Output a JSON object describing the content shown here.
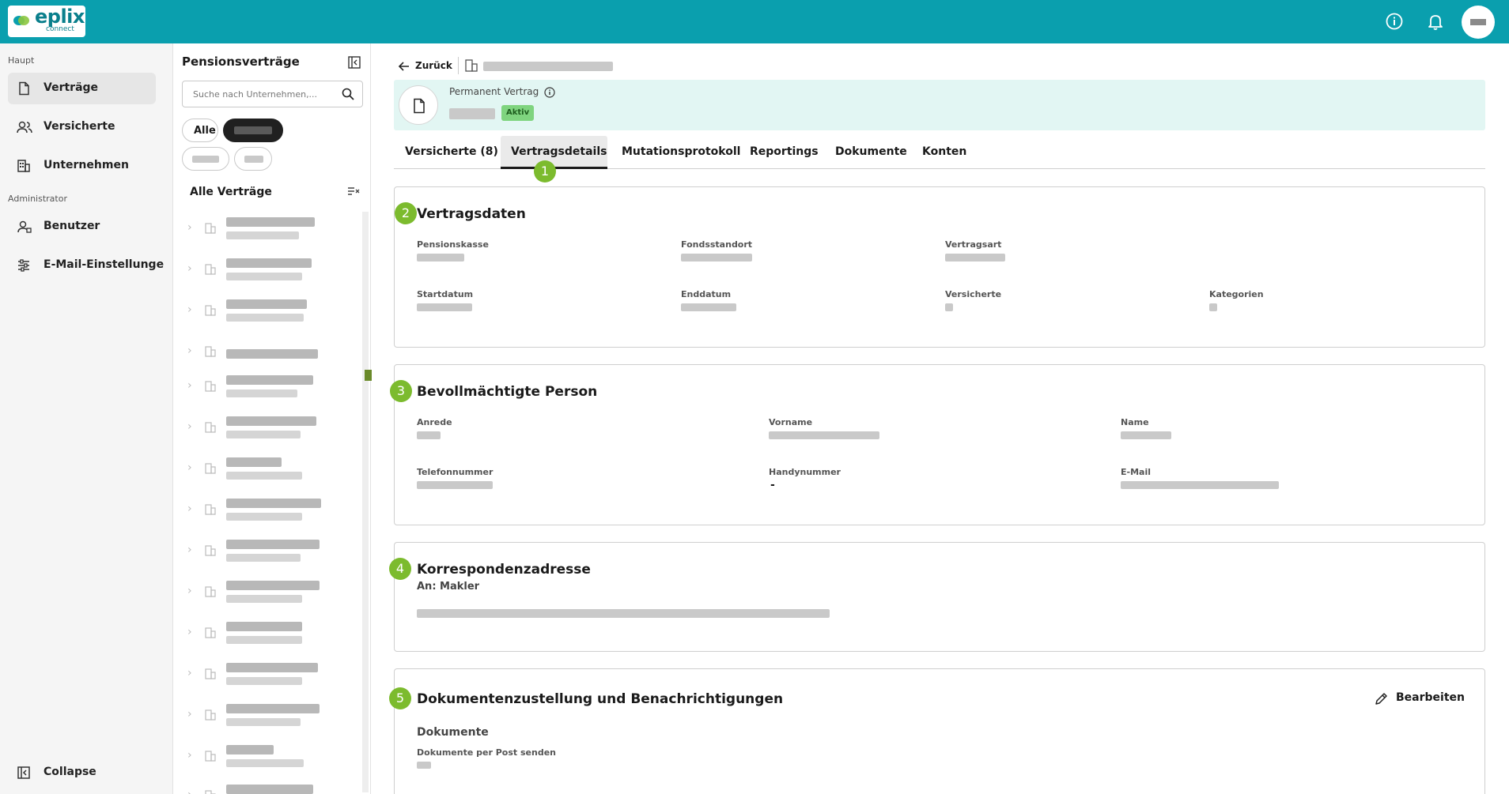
{
  "brand": {
    "name": "eplix",
    "sub": "connect"
  },
  "nav": {
    "section_main": "Haupt",
    "items_main": [
      {
        "label": "Verträge",
        "icon": "document-icon"
      },
      {
        "label": "Versicherte",
        "icon": "users-icon"
      },
      {
        "label": "Unternehmen",
        "icon": "building-icon"
      }
    ],
    "section_admin": "Administrator",
    "items_admin": [
      {
        "label": "Benutzer",
        "icon": "user-admin-icon"
      },
      {
        "label": "E-Mail-Einstellunge",
        "icon": "sliders-icon"
      }
    ],
    "collapse": "Collapse"
  },
  "list": {
    "title": "Pensionsverträge",
    "search_placeholder": "Suche nach Unternehmen,...",
    "chips": [
      "Alle"
    ],
    "subtitle": "Alle Verträge"
  },
  "main": {
    "back": "Zurück",
    "header": {
      "label": "Permanent Vertrag",
      "status": "Aktiv"
    },
    "tabs": [
      "Versicherte (8)",
      "Vertragsdetails",
      "Mutationsprotokoll",
      "Reportings",
      "Dokumente",
      "Konten"
    ],
    "markers": [
      "1",
      "2",
      "3",
      "4",
      "5"
    ],
    "vertragsdaten": {
      "title": "Vertragsdaten",
      "labels": [
        "Pensionskasse",
        "Fondsstandort",
        "Vertragsart",
        "Startdatum",
        "Enddatum",
        "Versicherte",
        "Kategorien"
      ]
    },
    "bevollmaechtigte": {
      "title": "Bevollmächtigte Person",
      "labels": [
        "Anrede",
        "Vorname",
        "Name",
        "Telefonnummer",
        "Handynummer",
        "E-Mail"
      ],
      "handynummer_value": "-"
    },
    "korrespondenz": {
      "title": "Korrespondenzadresse",
      "subtitle": "An: Makler"
    },
    "dokumente": {
      "title": "Dokumentenzustellung und Benachrichtigungen",
      "edit": "Bearbeiten",
      "section": "Dokumente",
      "field": "Dokumente per Post senden"
    }
  },
  "colors": {
    "topbar": "#0a9fae",
    "marker": "#7cbb2e",
    "status": "#7fd47f",
    "header_card": "#e2f6f3"
  }
}
